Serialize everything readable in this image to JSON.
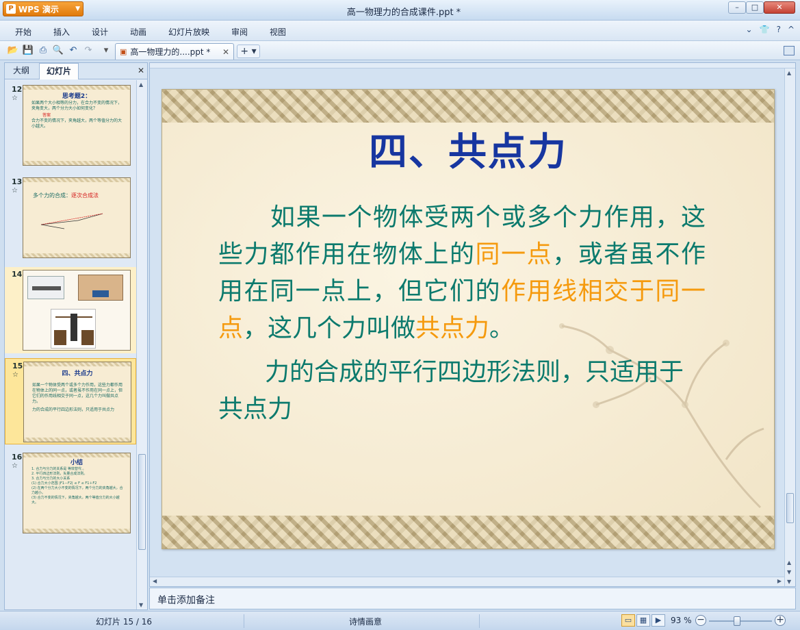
{
  "app": {
    "button_label": "WPS 演示",
    "window_title": "高一物理力的合成课件.ppt *"
  },
  "window_controls": {
    "minimize": "–",
    "maximize": "□",
    "close": "✕"
  },
  "menu": {
    "items": [
      "开始",
      "插入",
      "设计",
      "动画",
      "幻灯片放映",
      "审阅",
      "视图"
    ]
  },
  "help_icons": [
    "chevron-down-icon",
    "shirt-icon",
    "help-icon"
  ],
  "toolbar": {
    "doc_tab_label": "高一物理力的....ppt *",
    "doc_tab_close": "✕",
    "new_tab_label": "+ ▾"
  },
  "left_panel": {
    "tabs": [
      "大纲",
      "幻灯片"
    ],
    "close": "✕",
    "thumbnails": [
      {
        "number": "12",
        "title": "思考题2：",
        "lines": [
          "如果两个大小相等的分力，在合力不变的情况下，夹角变大，两个分力大小如何变化？",
          "答案",
          "合力不变的情况下，夹角越大，两个等值分力的大小越大。"
        ]
      },
      {
        "number": "13",
        "title": "多个力的合成：",
        "title_red": "逐次合成法"
      },
      {
        "number": "14"
      },
      {
        "number": "15",
        "title": "四、共点力",
        "lines": [
          "如果一个物体受两个或多个力作用，这些力都作用在物体上的同一点，或者虽不作用在同一点上，但它们的作用线相交于同一点，这几个力叫做共点力。",
          "力的合成的平行四边形法则，只适用于共点力"
        ]
      },
      {
        "number": "16",
        "title": "小结",
        "lines": [
          "1. 合力与分力的关系是 等效替代 。",
          "2. 平行四边形法则，矢量合成法则。",
          "3. 合力与分力的大小关系",
          "(1) 合力大小范围 |F1－F2| ≤ F ≤ F1＋F2",
          "(2) 在两个分力大小不变的情况下，两个分力的夹角越大，合力越小。",
          "(3) 合力不变的情况下，夹角越大，两个等值分力的大小越大。"
        ]
      }
    ],
    "star": "☆"
  },
  "slide": {
    "title": "四、共点力",
    "p1_a": "如果一个物体受两个或多个力作用，这些力都作用在物体上的",
    "p1_b": "同一点",
    "p1_c": "，或者虽不作用在同一点上，但它们的",
    "p1_d": "作用线相交于同一点",
    "p1_e": "，这几个力叫做",
    "p1_f": "共点力",
    "p1_g": "。",
    "p2": "力的合成的平行四边形法则，只适用于共点力"
  },
  "notes": {
    "placeholder": "单击添加备注"
  },
  "status": {
    "slide_info": "幻灯片 15 / 16",
    "theme": "诗情画意",
    "zoom": "93 %",
    "zoom_minus": "−",
    "zoom_plus": "+",
    "zoom_level_percent": 93
  },
  "colors": {
    "title_blue": "#1736a0",
    "body_teal": "#0c7a6d",
    "highlight_orange": "#f59a0e",
    "brand_orange": "#e07a0c"
  }
}
